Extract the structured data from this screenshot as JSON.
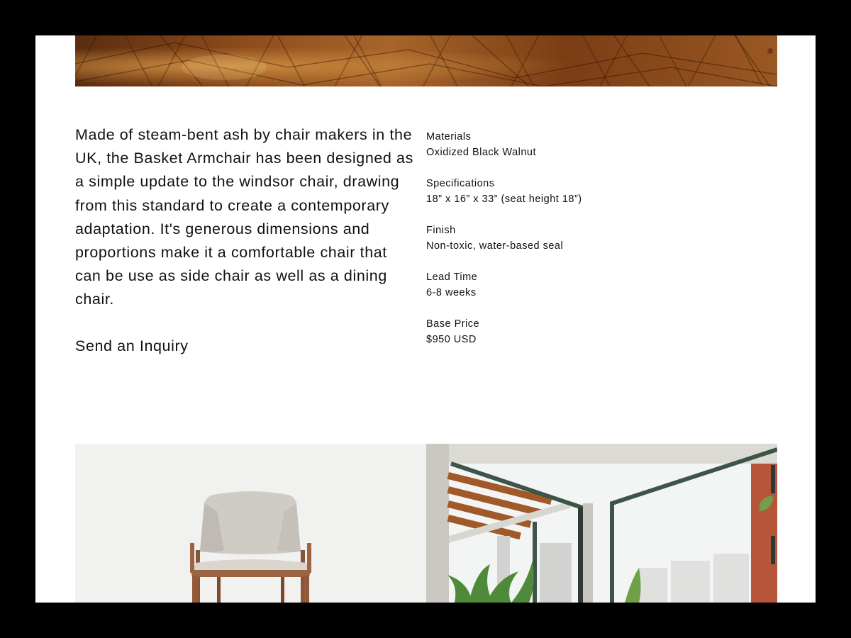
{
  "product": {
    "description": "Made of steam-bent ash by chair makers in the UK, the Basket Armchair has been designed as a simple update to the windsor chair, drawing from this standard to create a contemporary adaptation. It's generous dimensions and proportions make it a comfortable chair that can be use as side chair as well as a dining chair.",
    "inquiry_label": "Send an Inquiry"
  },
  "specs": [
    {
      "label": "Materials",
      "value": "Oxidized Black Walnut"
    },
    {
      "label": "Specifications",
      "value": "18” x 16” x 33” (seat height 18”)"
    },
    {
      "label": "Finish",
      "value": "Non-toxic, water-based seal"
    },
    {
      "label": "Lead Time",
      "value": "6-8 weeks"
    },
    {
      "label": "Base Price",
      "value": "$950 USD"
    }
  ],
  "images": {
    "hero": "wood-herringbone-floor",
    "left": "armchair-on-grey-background",
    "right": "interior-with-balcony-view"
  }
}
